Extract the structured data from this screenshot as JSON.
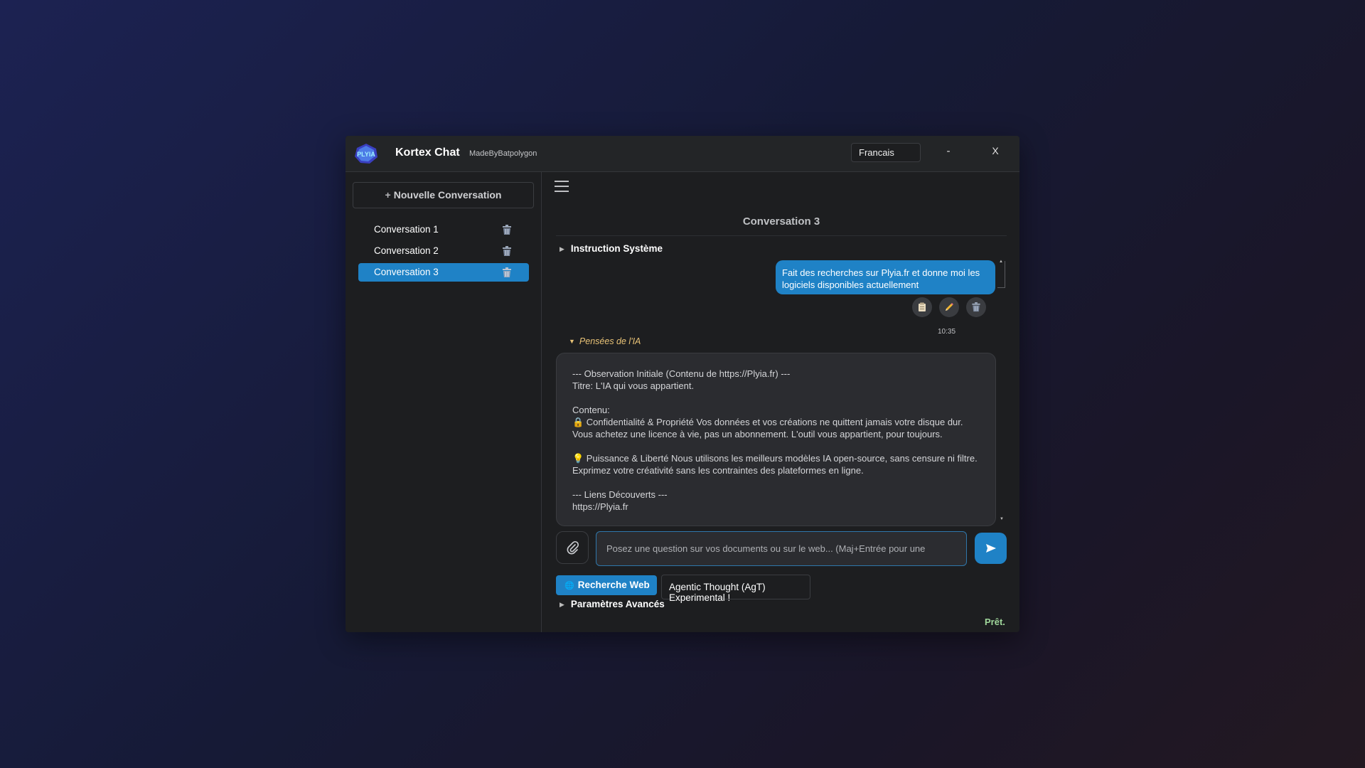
{
  "app": {
    "logo_text": "PLYIA",
    "title": "Kortex Chat",
    "subtitle": "MadeByBatpolygon",
    "language": "Francais",
    "minimize_label": "-",
    "close_label": "X"
  },
  "sidebar": {
    "new_conversation": "Nouvelle Conversation",
    "conversations": [
      {
        "label": "Conversation 1",
        "active": false
      },
      {
        "label": "Conversation 2",
        "active": false
      },
      {
        "label": "Conversation 3",
        "active": true
      }
    ]
  },
  "main": {
    "conversation_title": "Conversation 3",
    "system_instruction_label": "Instruction Système",
    "user_message": "Fait des recherches sur Plyia.fr et donne moi les logiciels disponibles actuellement",
    "message_time": "10:35",
    "message_actions": [
      "copy-icon",
      "edit-icon",
      "trash-icon"
    ],
    "thoughts_label": "Pensées de l'IA",
    "thoughts_lines": [
      "--- Observation Initiale (Contenu de https://Plyia.fr) ---",
      "Titre: L'IA qui vous appartient.",
      "",
      "Contenu:",
      "🔒 Confidentialité & Propriété Vos données et vos créations ne quittent jamais votre disque dur. Vous achetez une licence à vie, pas un abonnement. L'outil vous appartient, pour toujours.",
      "",
      "💡 Puissance & Liberté Nous utilisons les meilleurs modèles IA open-source, sans censure ni filtre. Exprimez votre créativité sans les contraintes des plateformes en ligne.",
      "",
      "--- Liens Découverts ---",
      "https://Plyia.fr"
    ],
    "input_placeholder": "Posez une question sur vos documents ou sur le web... (Maj+Entrée pour une",
    "web_search_label": "Recherche Web",
    "agentic_label": "Agentic Thought (AgT) Experimental !",
    "advanced_params_label": "Paramètres Avancés",
    "status": "Prêt."
  },
  "colors": {
    "accent": "#1f82c6",
    "status": "#9fd69a",
    "thoughts": "#e8c276"
  }
}
